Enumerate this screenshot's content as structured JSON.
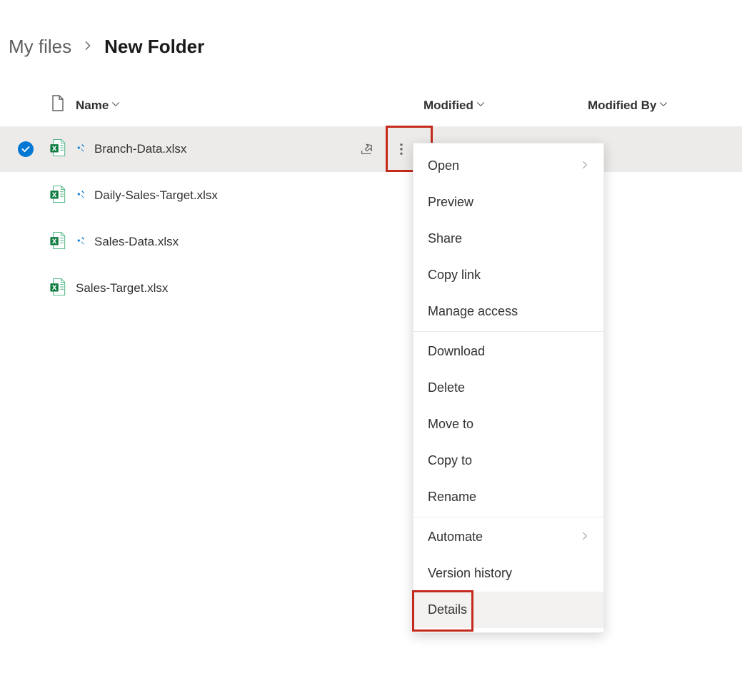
{
  "breadcrumb": {
    "root": "My files",
    "current": "New Folder"
  },
  "columns": {
    "name": "Name",
    "modified": "Modified",
    "modified_by": "Modified By"
  },
  "files": [
    {
      "name": "Branch-Data.xlsx",
      "selected": true,
      "new": true
    },
    {
      "name": "Daily-Sales-Target.xlsx",
      "selected": false,
      "new": true
    },
    {
      "name": "Sales-Data.xlsx",
      "selected": false,
      "new": true
    },
    {
      "name": "Sales-Target.xlsx",
      "selected": false,
      "new": false
    }
  ],
  "context_menu": {
    "groups": [
      [
        {
          "label": "Open",
          "submenu": true
        },
        {
          "label": "Preview"
        },
        {
          "label": "Share"
        },
        {
          "label": "Copy link"
        },
        {
          "label": "Manage access"
        }
      ],
      [
        {
          "label": "Download"
        },
        {
          "label": "Delete"
        },
        {
          "label": "Move to"
        },
        {
          "label": "Copy to"
        },
        {
          "label": "Rename"
        }
      ],
      [
        {
          "label": "Automate",
          "submenu": true
        },
        {
          "label": "Version history"
        },
        {
          "label": "Details",
          "highlighted": true
        }
      ]
    ]
  },
  "highlights": {
    "kebab_box": true,
    "details_box": true
  }
}
